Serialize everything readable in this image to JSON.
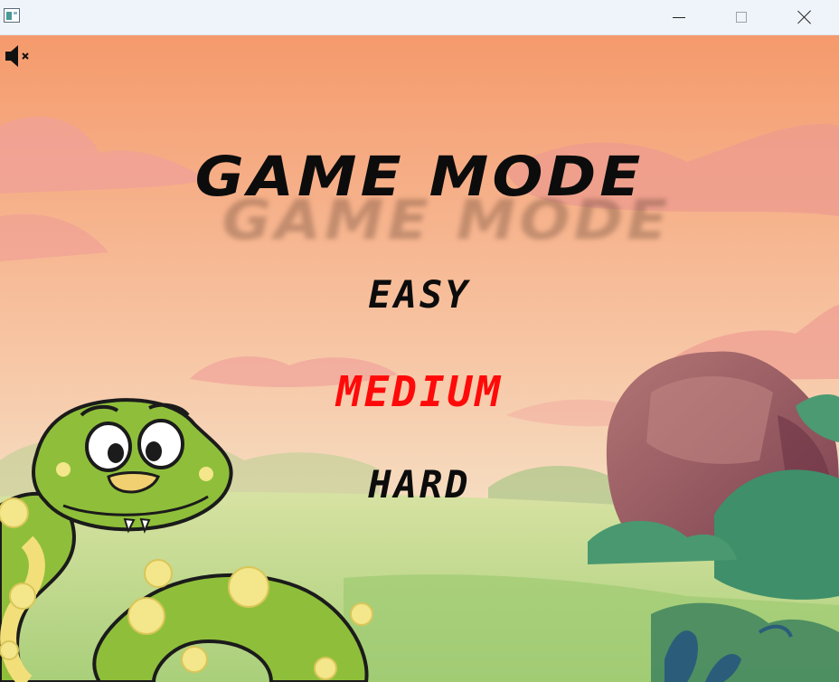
{
  "window": {
    "controls": [
      "minimize-icon",
      "maximize-icon",
      "close-icon"
    ]
  },
  "sound": {
    "icon": "speaker-muted-icon",
    "state": "muted"
  },
  "menu": {
    "title": "GAME MODE",
    "options": [
      {
        "label": "EASY",
        "color": "#0c0c0c",
        "selected": false
      },
      {
        "label": "MEDIUM",
        "color": "#ff0a0a",
        "selected": true
      },
      {
        "label": "HARD",
        "color": "#0c0c0c",
        "selected": false
      }
    ]
  },
  "colors": {
    "sky_top": "#f6a070",
    "sky_bottom": "#f8d2b0",
    "grass": "#b9d786",
    "highlight": "#ff0a0a"
  }
}
